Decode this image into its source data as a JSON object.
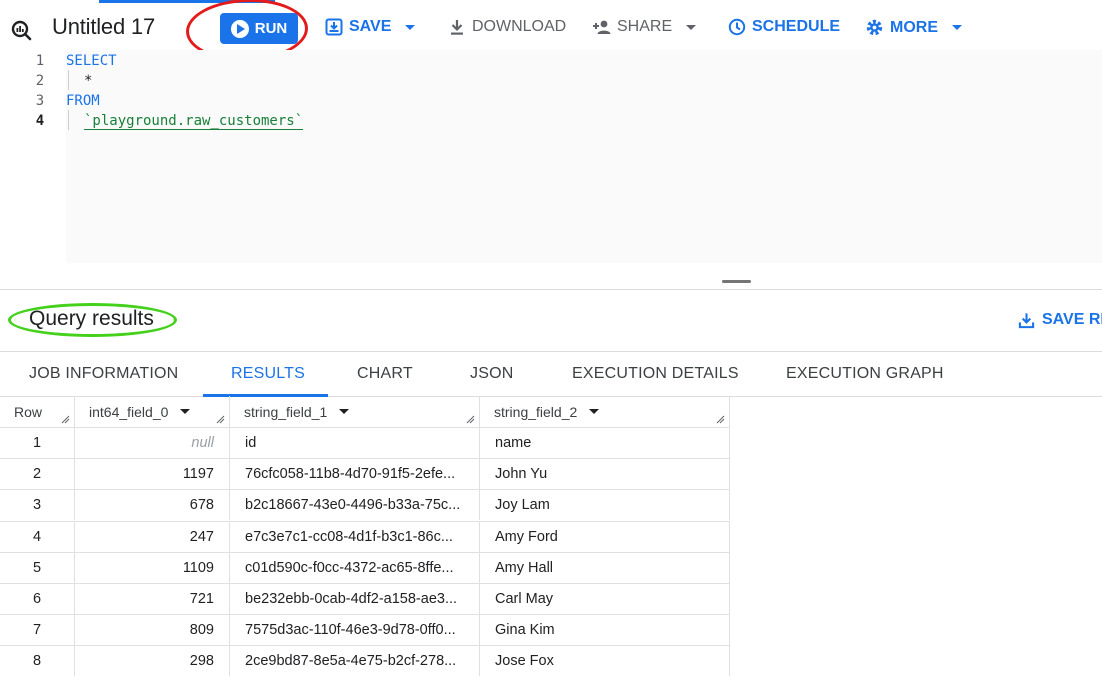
{
  "toolbar": {
    "query_icon": "query-editor-icon",
    "title": "Untitled 17",
    "run_label": "RUN",
    "save_label": "SAVE",
    "download_label": "DOWNLOAD",
    "share_label": "SHARE",
    "schedule_label": "SCHEDULE",
    "more_label": "MORE"
  },
  "editor": {
    "line_numbers": [
      "1",
      "2",
      "3",
      "4"
    ],
    "lines": {
      "l1": "SELECT",
      "l2": "*",
      "l3": "FROM",
      "l4": "`playground.raw_customers`"
    }
  },
  "results": {
    "title": "Query results",
    "save_results_label": "SAVE RE"
  },
  "tabs": [
    {
      "label": "JOB INFORMATION"
    },
    {
      "label": "RESULTS"
    },
    {
      "label": "CHART"
    },
    {
      "label": "JSON"
    },
    {
      "label": "EXECUTION DETAILS"
    },
    {
      "label": "EXECUTION GRAPH"
    }
  ],
  "table": {
    "columns": [
      "Row",
      "int64_field_0",
      "string_field_1",
      "string_field_2"
    ],
    "rows": [
      {
        "row": "1",
        "c0": "null",
        "c1": "id",
        "c2": "name"
      },
      {
        "row": "2",
        "c0": "1197",
        "c1": "76cfc058-11b8-4d70-91f5-2efe...",
        "c2": "John Yu"
      },
      {
        "row": "3",
        "c0": "678",
        "c1": "b2c18667-43e0-4496-b33a-75c...",
        "c2": "Joy Lam"
      },
      {
        "row": "4",
        "c0": "247",
        "c1": "e7c3e7c1-cc08-4d1f-b3c1-86c...",
        "c2": "Amy Ford"
      },
      {
        "row": "5",
        "c0": "1109",
        "c1": "c01d590c-f0cc-4372-ac65-8ffe...",
        "c2": "Amy Hall"
      },
      {
        "row": "6",
        "c0": "721",
        "c1": "be232ebb-0cab-4df2-a158-ae3...",
        "c2": "Carl May"
      },
      {
        "row": "7",
        "c0": "809",
        "c1": "7575d3ac-110f-46e3-9d78-0ff0...",
        "c2": "Gina Kim"
      },
      {
        "row": "8",
        "c0": "298",
        "c1": "2ce9bd87-8e5a-4e75-b2cf-278...",
        "c2": "Jose Fox"
      }
    ]
  },
  "colors": {
    "accent": "#1a73e8",
    "run_annotation": "#e31b1b",
    "results_annotation": "#43d11c"
  }
}
